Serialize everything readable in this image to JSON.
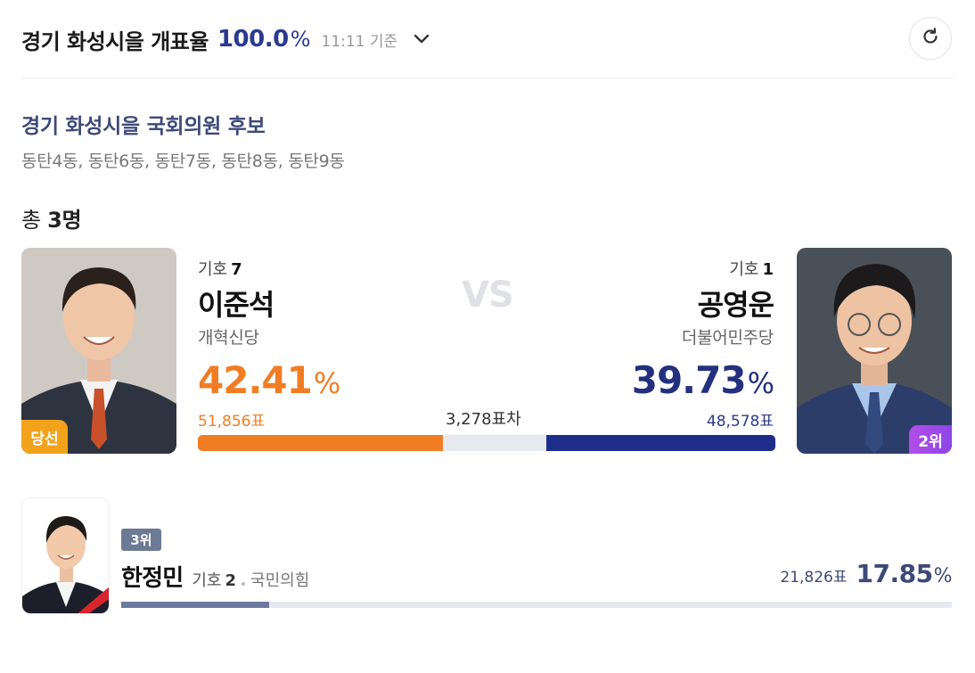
{
  "header": {
    "title": "경기 화성시을 개표율",
    "count_rate": "100.0",
    "count_rate_unit": "%",
    "time": "11:11 기준"
  },
  "district": {
    "title": "경기 화성시을 국회의원 후보",
    "dongs": "동탄4동, 동탄6동, 동탄7동, 동탄8동, 동탄9동",
    "total_prefix": "총",
    "total_count": "3명"
  },
  "vs_label": "VS",
  "candidates": [
    {
      "symbol_label": "기호",
      "symbol_no": "7",
      "name": "이준석",
      "party": "개혁신당",
      "percent": "42.41",
      "percent_value": 42.41,
      "votes": "51,856표",
      "badge": "당선",
      "color": "#f07d24"
    },
    {
      "symbol_label": "기호",
      "symbol_no": "1",
      "name": "공영운",
      "party": "더불어민주당",
      "percent": "39.73",
      "percent_value": 39.73,
      "votes": "48,578표",
      "badge": "2위",
      "color": "#1f2d8a"
    },
    {
      "rank": "3위",
      "symbol_label": "기호",
      "symbol_no": "2",
      "name": "한정민",
      "party": "국민의힘",
      "percent": "17.85",
      "percent_value": 17.85,
      "votes": "21,826표",
      "color": "#6c7a9e"
    }
  ],
  "vote_difference": "3,278표차",
  "percent_unit": "%",
  "colors": {
    "accent_navy": "#2b3a8f",
    "accent_orange": "#f07d24",
    "bar_background": "#e6e9f0"
  },
  "icons": {
    "refresh": "refresh-icon",
    "dropdown": "chevron-down-icon"
  }
}
